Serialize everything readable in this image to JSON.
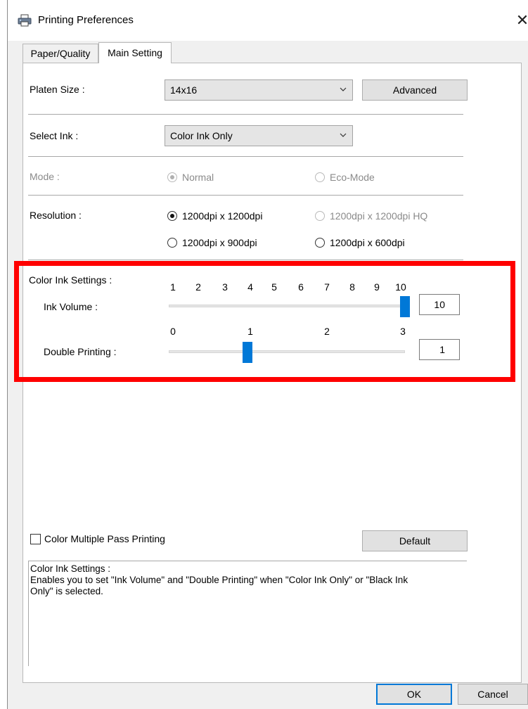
{
  "window": {
    "title": "Printing Preferences",
    "icon": "printer-icon"
  },
  "tabs": [
    {
      "label": "Paper/Quality",
      "active": false
    },
    {
      "label": "Main Setting",
      "active": true
    }
  ],
  "platen": {
    "label": "Platen Size :",
    "value": "14x16",
    "advanced_label": "Advanced"
  },
  "ink": {
    "label": "Select Ink :",
    "value": "Color Ink Only"
  },
  "mode": {
    "label": "Mode :",
    "options": [
      "Normal",
      "Eco-Mode"
    ],
    "selected": "Normal",
    "enabled": false
  },
  "resolution": {
    "label": "Resolution :",
    "options": [
      "1200dpi x 1200dpi",
      "1200dpi x 1200dpi HQ",
      "1200dpi x 900dpi",
      "1200dpi x 600dpi"
    ],
    "selected": "1200dpi x 1200dpi",
    "disabled_option": "1200dpi x 1200dpi HQ"
  },
  "color_ink_settings": {
    "label": "Color Ink Settings :",
    "ink_volume": {
      "label": "Ink Volume :",
      "ticks": [
        "1",
        "2",
        "3",
        "4",
        "5",
        "6",
        "7",
        "8",
        "9",
        "10"
      ],
      "min": 1,
      "max": 10,
      "value": "10"
    },
    "double_printing": {
      "label": "Double Printing :",
      "ticks": [
        "0",
        "1",
        "2",
        "3"
      ],
      "min": 0,
      "max": 3,
      "value": "1"
    }
  },
  "multipass": {
    "label": "Color Multiple Pass Printing",
    "checked": false
  },
  "default_label": "Default",
  "description": {
    "line1": "Color Ink Settings :",
    "line2": "Enables you to set \"Ink Volume\" and \"Double Printing\" when \"Color Ink Only\" or \"Black Ink",
    "line3": "Only\" is selected."
  },
  "footer": {
    "ok_label": "OK",
    "cancel_label": "Cancel"
  },
  "colors": {
    "accent": "#0078d7",
    "highlight": "#ff0000"
  }
}
